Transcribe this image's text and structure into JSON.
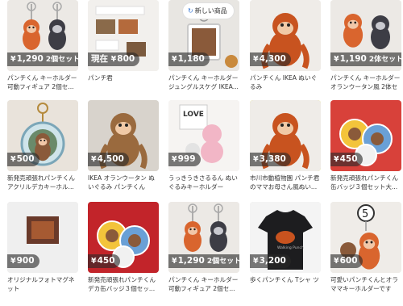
{
  "items": [
    {
      "price": "1,290",
      "suffix": "2個セット",
      "title": "パンチくん キーホルダー 可動フィギュア 2個セ..."
    },
    {
      "price": "800",
      "prefix": "現在",
      "title": "パンチ君"
    },
    {
      "price": "1,180",
      "title": "パンチくん キーホルダー ジュングルスケグ IKEA...",
      "badge": "新しい商品"
    },
    {
      "price": "4,300",
      "title": "パンチくん IKEA ぬいぐるみ"
    },
    {
      "price": "1,190",
      "suffix": "2体セット",
      "title": "パンチくん キーホルダー オランウータン風 2体セット..."
    },
    {
      "price": "500",
      "title": "新発売頑張れパンチくん アクリルデカキーホル..."
    },
    {
      "price": "4,500",
      "title": "IKEA オランウータン ぬいぐるみ パンチくん"
    },
    {
      "price": "999",
      "title": "うっきうきさるるん ぬいぐるみキーホルダー"
    },
    {
      "price": "3,380",
      "title": "市川市動植物園 パンチ君 のママお母さん風ぬい..."
    },
    {
      "price": "450",
      "title": "新発売頑張れパンチくん 缶バッジ３個セット大..."
    },
    {
      "price": "900",
      "title": "オリジナルフォトマグネ ット"
    },
    {
      "price": "450",
      "title": "新発売頑張れパンチくん デカ缶バッジ３個セッ..."
    },
    {
      "price": "1,290",
      "suffix": "2個セット",
      "title": "パンチくん キーホルダー 可動フィギュア 2個セ..."
    },
    {
      "price": "3,200",
      "title": "歩くパンチくん Tシャ ツ"
    },
    {
      "price": "600",
      "title": "可愛いパンチくんとオラ ママキーホルダーです"
    }
  ],
  "thumb_art": [
    "orangutan-keychains",
    "photo-cards",
    "keychain-frame",
    "orangutan-plush",
    "orangutan-keychains-2",
    "acrylic-keychain",
    "orangutan-plush-2",
    "love-plush",
    "orangutan-plush-3",
    "can-badges",
    "photo-magnet",
    "can-badges-2",
    "orangutan-keychains",
    "t-shirt",
    "number-keychain"
  ],
  "currency_symbol": "¥",
  "colors": {
    "price_bg": "rgba(40,40,40,0.62)",
    "highlight_border": "#e7dd3c",
    "new_badge_icon": "#3c7bd6"
  }
}
